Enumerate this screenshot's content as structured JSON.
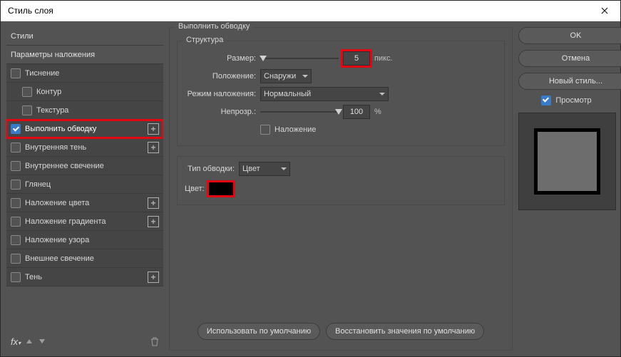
{
  "window": {
    "title": "Стиль слоя"
  },
  "sidebar": {
    "header_styles": "Стили",
    "header_blending": "Параметры наложения",
    "items": [
      {
        "label": "Тиснение",
        "checked": false,
        "indent": false,
        "add": false
      },
      {
        "label": "Контур",
        "checked": false,
        "indent": true,
        "add": false
      },
      {
        "label": "Текстура",
        "checked": false,
        "indent": true,
        "add": false
      },
      {
        "label": "Выполнить обводку",
        "checked": true,
        "indent": false,
        "add": true
      },
      {
        "label": "Внутренняя тень",
        "checked": false,
        "indent": false,
        "add": true
      },
      {
        "label": "Внутреннее свечение",
        "checked": false,
        "indent": false,
        "add": false
      },
      {
        "label": "Глянец",
        "checked": false,
        "indent": false,
        "add": false
      },
      {
        "label": "Наложение цвета",
        "checked": false,
        "indent": false,
        "add": true
      },
      {
        "label": "Наложение градиента",
        "checked": false,
        "indent": false,
        "add": true
      },
      {
        "label": "Наложение узора",
        "checked": false,
        "indent": false,
        "add": false
      },
      {
        "label": "Внешнее свечение",
        "checked": false,
        "indent": false,
        "add": false
      },
      {
        "label": "Тень",
        "checked": false,
        "indent": false,
        "add": true
      }
    ]
  },
  "panel": {
    "title": "Выполнить обводку",
    "structure_title": "Структура",
    "size_label": "Размер:",
    "size_value": "5",
    "size_unit": "пикс.",
    "position_label": "Положение:",
    "position_value": "Снаружи",
    "blend_label": "Режим наложения:",
    "blend_value": "Нормальный",
    "opacity_label": "Непрозр.:",
    "opacity_value": "100",
    "opacity_unit": "%",
    "overprint_label": "Наложение",
    "filltype_label": "Тип обводки:",
    "filltype_value": "Цвет",
    "color_label": "Цвет:",
    "color_hex": "#000000",
    "make_default": "Использовать по умолчанию",
    "reset_default": "Восстановить значения по умолчанию"
  },
  "right": {
    "ok": "OK",
    "cancel": "Отмена",
    "new_style": "Новый стиль...",
    "preview": "Просмотр"
  }
}
